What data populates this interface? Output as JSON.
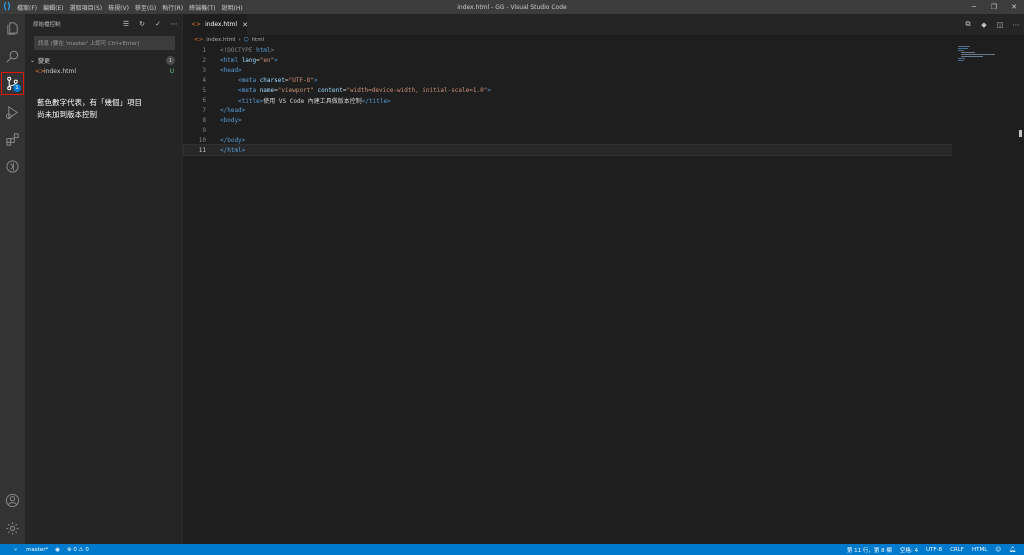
{
  "titlebar": {
    "menu": [
      "檔案(F)",
      "編輯(E)",
      "選取項目(S)",
      "檢視(V)",
      "移至(G)",
      "執行(R)",
      "終端機(T)",
      "說明(H)"
    ],
    "window_title": "index.html - GG - Visual Studio Code"
  },
  "activity": {
    "scm_badge": "1",
    "accent_color": "#007acc",
    "highlight_color": "#e51400"
  },
  "sidebar": {
    "title": "原始檔控制",
    "commit_placeholder": "訊息 (要在 'master' 上認可 Ctrl+Enter)",
    "group_label": "變更",
    "group_count": "1",
    "file_name": "index.html",
    "file_status": "U"
  },
  "annotation": {
    "line1": "藍色數字代表，有「幾個」項目",
    "line2": "尚未加到版本控制"
  },
  "editor": {
    "tab_label": "index.html",
    "breadcrumb_file": "index.html",
    "breadcrumb_symbol": "html",
    "line_numbers": [
      "1",
      "2",
      "3",
      "4",
      "5",
      "6",
      "7",
      "8",
      "9",
      "10",
      "11"
    ],
    "code": {
      "l1": [
        "<!DOCTYPE ",
        "html",
        ">"
      ],
      "l2": [
        "<html ",
        "lang",
        "=",
        "\"en\"",
        ">"
      ],
      "l3": [
        "<head>"
      ],
      "l4": [
        "<meta ",
        "charset",
        "=",
        "\"UTF-8\"",
        ">"
      ],
      "l5": [
        "<meta ",
        "name",
        "=",
        "\"viewport\"",
        " ",
        "content",
        "=",
        "\"width=device-width, initial-scale=1.0\"",
        ">"
      ],
      "l6": [
        "<title>",
        "使用 VS Code 內建工具做版本控制",
        "</title>"
      ],
      "l7": [
        "</head>"
      ],
      "l8": [
        "<body>"
      ],
      "l10": [
        "</body>"
      ],
      "l11": [
        "</html>"
      ]
    }
  },
  "statusbar": {
    "branch": "master*",
    "problems": "⊗ 0 ⚠ 0",
    "position": "第 11 行，第 8 欄",
    "spaces": "空格: 4",
    "encoding": "UTF-8",
    "eol": "CRLF",
    "language": "HTML"
  }
}
